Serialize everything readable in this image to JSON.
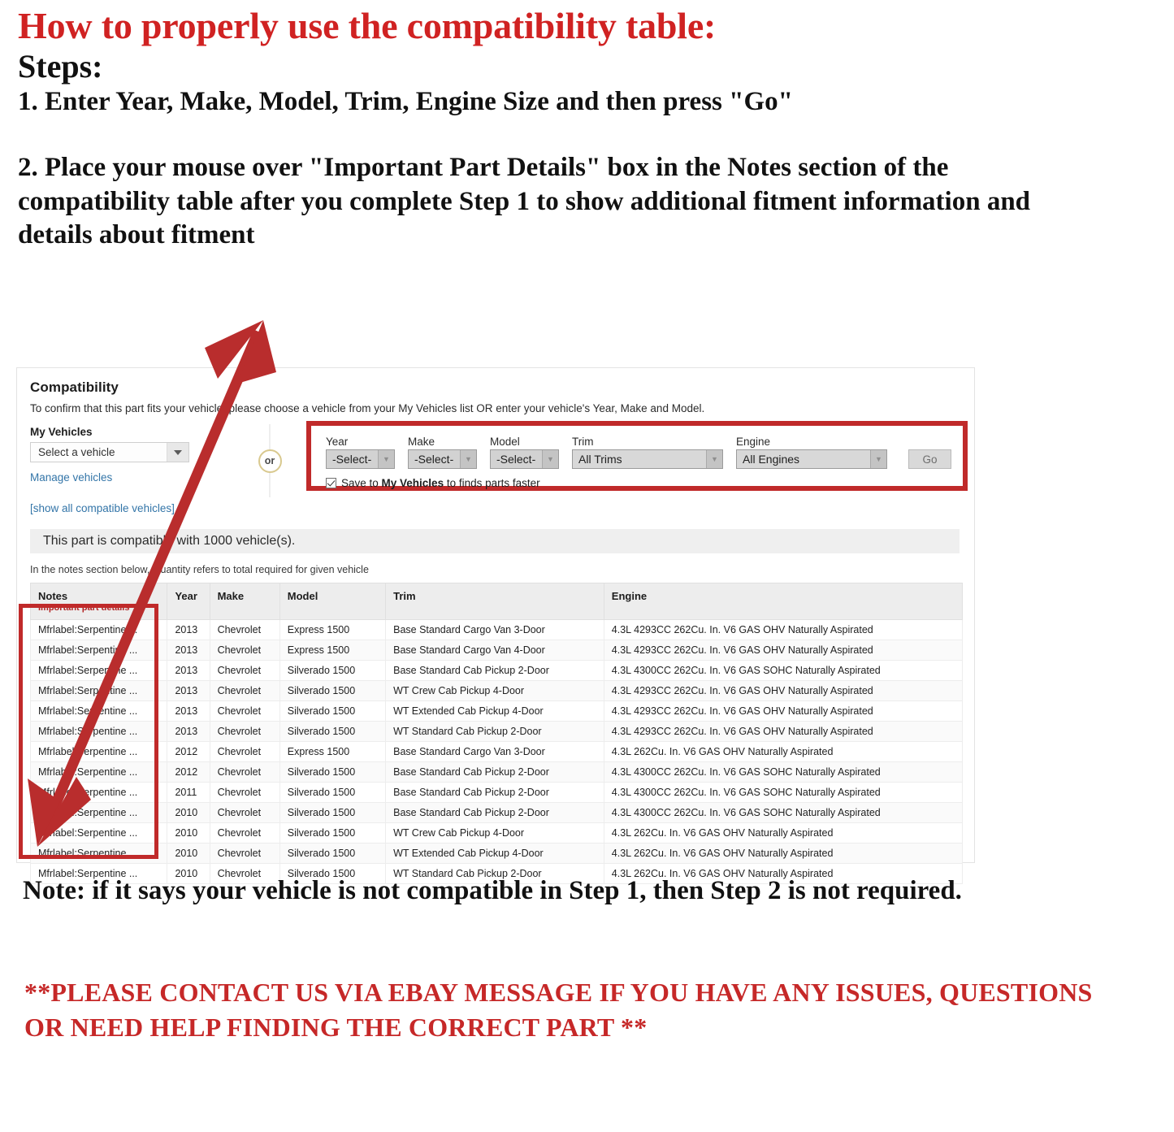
{
  "instructions": {
    "headline": "How to properly use the compatibility table:",
    "steps_label": "Steps:",
    "step_one": "1. Enter Year, Make, Model, Trim, Engine Size and then press \"Go\"",
    "step_two": "2. Place your mouse over \"Important Part Details\" box in the Notes section of the compatibility table after you complete Step 1 to show additional fitment information and details about fitment",
    "note": "Note: if it says your vehicle is not compatible in Step 1, then Step 2 is not required.",
    "contact": "**PLEASE CONTACT US VIA EBAY MESSAGE IF YOU HAVE ANY ISSUES, QUESTIONS OR NEED HELP FINDING THE CORRECT PART **"
  },
  "compatibility": {
    "title": "Compatibility",
    "subtitle": "To confirm that this part fits your vehicle, please choose a vehicle from your My Vehicles list OR enter your vehicle's Year, Make and Model.",
    "my_vehicles": {
      "label": "My Vehicles",
      "select_value": "Select a vehicle",
      "manage_link": "Manage vehicles",
      "show_all_link": "[show all compatible vehicles]"
    },
    "or_badge": "or",
    "finder": {
      "year": {
        "label": "Year",
        "value": "-Select-"
      },
      "make": {
        "label": "Make",
        "value": "-Select-"
      },
      "model": {
        "label": "Model",
        "value": "-Select-"
      },
      "trim": {
        "label": "Trim",
        "value": "All Trims"
      },
      "engine": {
        "label": "Engine",
        "value": "All Engines"
      },
      "go_label": "Go",
      "save_prefix": "Save to ",
      "save_bold": "My Vehicles",
      "save_suffix": " to finds parts faster"
    },
    "result_banner": "This part is compatible with 1000 vehicle(s).",
    "notes_hint": "In the notes section below, Quantity refers to total required for given vehicle",
    "table": {
      "headers": {
        "notes": "Notes",
        "notes_sub": "Important part details",
        "year": "Year",
        "make": "Make",
        "model": "Model",
        "trim": "Trim",
        "engine": "Engine"
      },
      "rows": [
        {
          "notes": "Mfrlabel:Serpentine ...",
          "year": "2013",
          "make": "Chevrolet",
          "model": "Express 1500",
          "trim": "Base Standard Cargo Van 3-Door",
          "engine": "4.3L 4293CC 262Cu. In. V6 GAS OHV Naturally Aspirated"
        },
        {
          "notes": "Mfrlabel:Serpentine ...",
          "year": "2013",
          "make": "Chevrolet",
          "model": "Express 1500",
          "trim": "Base Standard Cargo Van 4-Door",
          "engine": "4.3L 4293CC 262Cu. In. V6 GAS OHV Naturally Aspirated"
        },
        {
          "notes": "Mfrlabel:Serpentine ...",
          "year": "2013",
          "make": "Chevrolet",
          "model": "Silverado 1500",
          "trim": "Base Standard Cab Pickup 2-Door",
          "engine": "4.3L 4300CC 262Cu. In. V6 GAS SOHC Naturally Aspirated"
        },
        {
          "notes": "Mfrlabel:Serpentine ...",
          "year": "2013",
          "make": "Chevrolet",
          "model": "Silverado 1500",
          "trim": "WT Crew Cab Pickup 4-Door",
          "engine": "4.3L 4293CC 262Cu. In. V6 GAS OHV Naturally Aspirated"
        },
        {
          "notes": "Mfrlabel:Serpentine ...",
          "year": "2013",
          "make": "Chevrolet",
          "model": "Silverado 1500",
          "trim": "WT Extended Cab Pickup 4-Door",
          "engine": "4.3L 4293CC 262Cu. In. V6 GAS OHV Naturally Aspirated"
        },
        {
          "notes": "Mfrlabel:Serpentine ...",
          "year": "2013",
          "make": "Chevrolet",
          "model": "Silverado 1500",
          "trim": "WT Standard Cab Pickup 2-Door",
          "engine": "4.3L 4293CC 262Cu. In. V6 GAS OHV Naturally Aspirated"
        },
        {
          "notes": "Mfrlabel:Serpentine ...",
          "year": "2012",
          "make": "Chevrolet",
          "model": "Express 1500",
          "trim": "Base Standard Cargo Van 3-Door",
          "engine": "4.3L 262Cu. In. V6 GAS OHV Naturally Aspirated"
        },
        {
          "notes": "Mfrlabel:Serpentine ...",
          "year": "2012",
          "make": "Chevrolet",
          "model": "Silverado 1500",
          "trim": "Base Standard Cab Pickup 2-Door",
          "engine": "4.3L 4300CC 262Cu. In. V6 GAS SOHC Naturally Aspirated"
        },
        {
          "notes": "Mfrlabel:Serpentine ...",
          "year": "2011",
          "make": "Chevrolet",
          "model": "Silverado 1500",
          "trim": "Base Standard Cab Pickup 2-Door",
          "engine": "4.3L 4300CC 262Cu. In. V6 GAS SOHC Naturally Aspirated"
        },
        {
          "notes": "Mfrlabel:Serpentine ...",
          "year": "2010",
          "make": "Chevrolet",
          "model": "Silverado 1500",
          "trim": "Base Standard Cab Pickup 2-Door",
          "engine": "4.3L 4300CC 262Cu. In. V6 GAS SOHC Naturally Aspirated"
        },
        {
          "notes": "Mfrlabel:Serpentine ...",
          "year": "2010",
          "make": "Chevrolet",
          "model": "Silverado 1500",
          "trim": "WT Crew Cab Pickup 4-Door",
          "engine": "4.3L 262Cu. In. V6 GAS OHV Naturally Aspirated"
        },
        {
          "notes": "Mfrlabel:Serpentine ...",
          "year": "2010",
          "make": "Chevrolet",
          "model": "Silverado 1500",
          "trim": "WT Extended Cab Pickup 4-Door",
          "engine": "4.3L 262Cu. In. V6 GAS OHV Naturally Aspirated"
        },
        {
          "notes": "Mfrlabel:Serpentine ...",
          "year": "2010",
          "make": "Chevrolet",
          "model": "Silverado 1500",
          "trim": "WT Standard Cab Pickup 2-Door",
          "engine": "4.3L 262Cu. In. V6 GAS OHV Naturally Aspirated"
        }
      ]
    }
  },
  "colors": {
    "headline_red": "#d02222",
    "annotation_red": "#c02a2a",
    "contact_red": "#c62828",
    "link_blue": "#3375a8",
    "important_red": "#b32626"
  }
}
